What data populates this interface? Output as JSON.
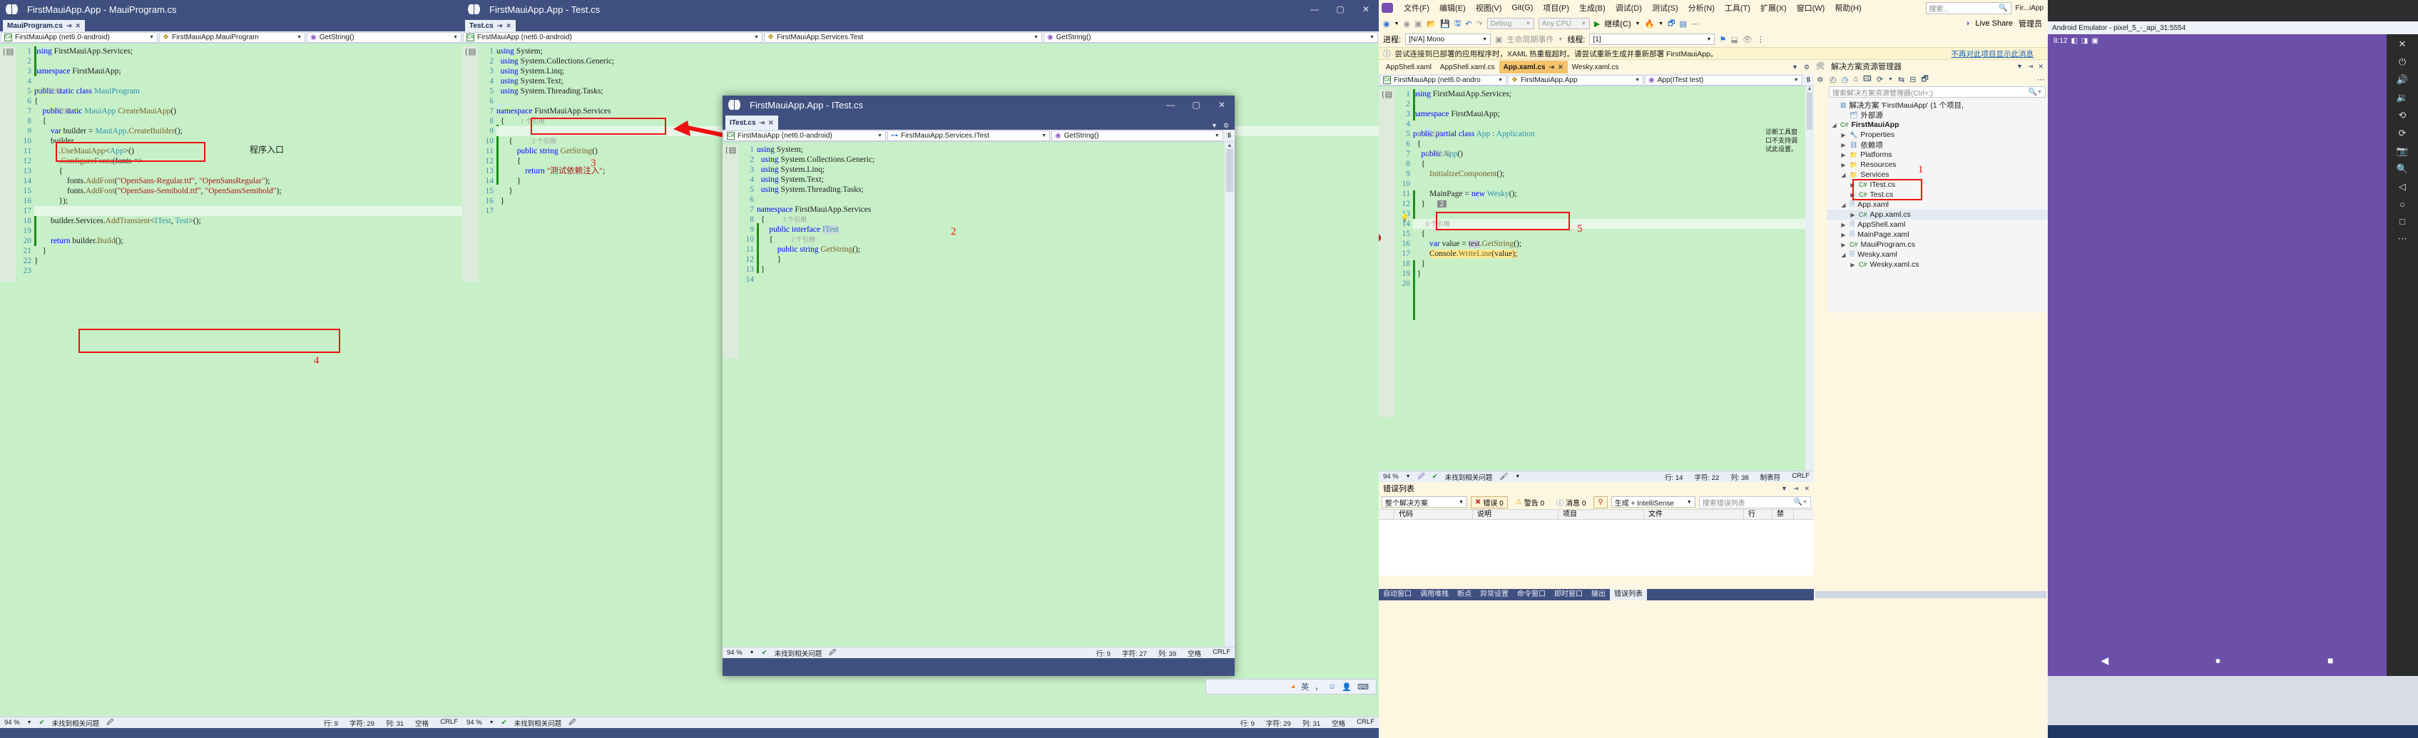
{
  "window1": {
    "title": "FirstMauiApp.App - MauiProgram.cs",
    "tab": "MauiProgram.cs",
    "nav": {
      "project": "FirstMauiApp (net6.0-android)",
      "type": "FirstMauiApp.MauiProgram",
      "member": "GetString()"
    },
    "annotation_program_entry": "程序入口",
    "marker_4": "4",
    "lines": [
      {
        "n": "1",
        "code": "using FirstMauiApp.Services;"
      },
      {
        "n": "2",
        "code": ""
      },
      {
        "n": "3",
        "code": "namespace FirstMauiApp;"
      },
      {
        "n": "4",
        "code": ""
      },
      {
        "n": "5",
        "code": "public static class MauiProgram"
      },
      {
        "n": "6",
        "code": "{"
      },
      {
        "n": "7",
        "code": "    public static MauiApp CreateMauiApp()"
      },
      {
        "n": "8",
        "code": "    {"
      },
      {
        "n": "9",
        "code": "        var builder = MauiApp.CreateBuilder();"
      },
      {
        "n": "10",
        "code": "        builder"
      },
      {
        "n": "11",
        "code": "            .UseMauiApp<App>()"
      },
      {
        "n": "12",
        "code": "            .ConfigureFonts(fonts =>"
      },
      {
        "n": "13",
        "code": "            {"
      },
      {
        "n": "14",
        "code": "                fonts.AddFont(\"OpenSans-Regular.ttf\", \"OpenSansRegular\");"
      },
      {
        "n": "15",
        "code": "                fonts.AddFont(\"OpenSans-Semibold.ttf\", \"OpenSansSemibold\");"
      },
      {
        "n": "16",
        "code": "            });"
      },
      {
        "n": "17",
        "code": ""
      },
      {
        "n": "18",
        "code": "        builder.Services.AddTransient<ITest, Test>();"
      },
      {
        "n": "19",
        "code": ""
      },
      {
        "n": "20",
        "code": "        return builder.Build();"
      },
      {
        "n": "21",
        "code": "    }"
      },
      {
        "n": "22",
        "code": "}"
      },
      {
        "n": "23",
        "code": ""
      }
    ],
    "refhint_class": "4 个引用",
    "refhint_method": "4 个引用",
    "status": {
      "zoom": "94 %",
      "issues": "未找到相关问题",
      "row": "行: 9",
      "char": "字符: 29",
      "col": "列: 31",
      "tab": "空格",
      "eol": "CRLF"
    }
  },
  "window2": {
    "title": "FirstMauiApp.App - Test.cs",
    "tab": "Test.cs",
    "nav": {
      "project": "FirstMauiApp (net6.0-android)",
      "type": "FirstMauiApp.Services.Test",
      "member": "GetString()"
    },
    "marker_3": "3",
    "refhint_class": "1 个引用",
    "refhint_method": "2 个引用",
    "lines": [
      {
        "n": "1",
        "code": "using System;"
      },
      {
        "n": "2",
        "code": "using System.Collections.Generic;"
      },
      {
        "n": "3",
        "code": "using System.Linq;"
      },
      {
        "n": "4",
        "code": "using System.Text;"
      },
      {
        "n": "5",
        "code": "using System.Threading.Tasks;"
      },
      {
        "n": "6",
        "code": ""
      },
      {
        "n": "7",
        "code": "namespace FirstMauiApp.Services"
      },
      {
        "n": "8",
        "code": "{"
      },
      {
        "n": "9",
        "code": "    public class Test: ITest"
      },
      {
        "n": "10",
        "code": "    {"
      },
      {
        "n": "11",
        "code": "        public string GetString()"
      },
      {
        "n": "12",
        "code": "        {"
      },
      {
        "n": "13",
        "code": "            return \"测试依赖注入\";"
      },
      {
        "n": "14",
        "code": "        }"
      },
      {
        "n": "15",
        "code": "    }"
      },
      {
        "n": "16",
        "code": "}"
      },
      {
        "n": "17",
        "code": ""
      }
    ],
    "status": {
      "zoom": "94 %",
      "issues": "未找到相关问题",
      "row": "行: 9",
      "char": "字符: 29",
      "col": "列: 31",
      "tab": "空格",
      "eol": "CRLF"
    }
  },
  "window3": {
    "title": "FirstMauiApp.App - ITest.cs",
    "tab": "ITest.cs",
    "nav": {
      "project": "FirstMauiApp (net6.0-android)",
      "type": "FirstMauiApp.Services.ITest",
      "member": "GetString()"
    },
    "marker_2": "2",
    "refhint_iface": "3 个引用",
    "refhint_method": "2 个引用",
    "lines": [
      {
        "n": "1",
        "code": "using System;"
      },
      {
        "n": "2",
        "code": "using System.Collections.Generic;"
      },
      {
        "n": "3",
        "code": "using System.Linq;"
      },
      {
        "n": "4",
        "code": "using System.Text;"
      },
      {
        "n": "5",
        "code": "using System.Threading.Tasks;"
      },
      {
        "n": "6",
        "code": ""
      },
      {
        "n": "7",
        "code": "namespace FirstMauiApp.Services"
      },
      {
        "n": "8",
        "code": "{"
      },
      {
        "n": "9",
        "code": "    public interface ITest"
      },
      {
        "n": "10",
        "code": "    {"
      },
      {
        "n": "11",
        "code": "        public string GetString();"
      },
      {
        "n": "12",
        "code": "    }"
      },
      {
        "n": "13",
        "code": "}"
      },
      {
        "n": "14",
        "code": ""
      }
    ],
    "status": {
      "zoom": "94 %",
      "issues": "未找到相关问题",
      "row": "行: 9",
      "char": "字符: 27",
      "col": "列: 39",
      "tab": "空格",
      "eol": "CRLF"
    }
  },
  "window4": {
    "menus": [
      "文件(F)",
      "编辑(E)",
      "视图(V)",
      "Git(G)",
      "项目(P)",
      "生成(B)",
      "调试(D)",
      "测试(S)",
      "分析(N)",
      "工具(T)",
      "扩展(X)",
      "窗口(W)",
      "帮助(H)"
    ],
    "search_placeholder": "搜索...",
    "titlebar_text": "Fir...iApp",
    "live_share": "Live Share",
    "feedback": "管理员",
    "toolbar": {
      "config": "Debug",
      "platform": "Any CPU",
      "run": "继续(C)"
    },
    "debugbar": {
      "process_label": "进程:",
      "process_value": "[N/A] Mono",
      "lifecycle": "生命周期事件",
      "thread_label": "线程:",
      "thread_value": "[1]"
    },
    "infobar": {
      "message": "尝试连接到已部署的应用程序时，XAML 热重载超时。请尝试重新生成并重新部署 FirstMauiApp。",
      "link": "不再对此项目显示此消息"
    },
    "tabs": [
      {
        "label": "AppShell.xaml",
        "active": false
      },
      {
        "label": "AppShell.xaml.cs",
        "active": false
      },
      {
        "label": "App.xaml.cs",
        "active": true
      },
      {
        "label": "Wesky.xaml.cs",
        "active": false
      }
    ],
    "nav": {
      "project": "FirstMauiApp (net6.0-andro",
      "type": "FirstMauiApp.App",
      "member": "App(ITest test)"
    },
    "marker_5": "5",
    "marker_2_badge": "2",
    "refhint_class": "6 个引用",
    "refhint_ctor": "0 个引用",
    "refhint_ctor2": "0 个引用",
    "lines": [
      {
        "n": "1",
        "code": "using FirstMauiApp.Services;"
      },
      {
        "n": "2",
        "code": ""
      },
      {
        "n": "3",
        "code": "namespace FirstMauiApp;"
      },
      {
        "n": "4",
        "code": ""
      },
      {
        "n": "5",
        "code": "public partial class App : Application"
      },
      {
        "n": "6",
        "code": "{"
      },
      {
        "n": "7",
        "code": "    public App()"
      },
      {
        "n": "8",
        "code": "    {"
      },
      {
        "n": "9",
        "code": "        InitializeComponent();"
      },
      {
        "n": "10",
        "code": ""
      },
      {
        "n": "11",
        "code": "        MainPage = new Wesky();"
      },
      {
        "n": "12",
        "code": "    }"
      },
      {
        "n": "13",
        "code": ""
      },
      {
        "n": "14",
        "code": "    public App(ITest test)"
      },
      {
        "n": "15",
        "code": "    {"
      },
      {
        "n": "16",
        "code": "        var value = test.GetString();"
      },
      {
        "n": "17",
        "code": "        Console.WriteLine(value);"
      },
      {
        "n": "18",
        "code": "    }"
      },
      {
        "n": "19",
        "code": "}"
      },
      {
        "n": "20",
        "code": ""
      }
    ],
    "status": {
      "zoom": "94 %",
      "issues": "未找到相关问题",
      "row": "行: 14",
      "char": "字符: 22",
      "col": "列: 38",
      "tab": "制表符",
      "eol": "CRLF"
    },
    "diagnostic_tool_text": "诊断工具窗口不支持调试此设置。",
    "solution_explorer": {
      "title": "解决方案资源管理器",
      "search_placeholder": "搜索解决方案资源管理器(Ctrl+;)",
      "marker_1": "1",
      "items": [
        {
          "label": "解决方案 'FirstMauiApp' (1 个项目,",
          "icon": "solution",
          "indent": 0,
          "twisty": "",
          "bold": false
        },
        {
          "label": "外部源",
          "icon": "ext",
          "indent": 1,
          "twisty": "",
          "bold": false
        },
        {
          "label": "FirstMauiApp",
          "icon": "csproj",
          "indent": 0,
          "twisty": "▲",
          "bold": true
        },
        {
          "label": "Properties",
          "icon": "props",
          "indent": 1,
          "twisty": "▶",
          "bold": false
        },
        {
          "label": "依赖项",
          "icon": "deps",
          "indent": 1,
          "twisty": "▶",
          "bold": false
        },
        {
          "label": "Platforms",
          "icon": "folder",
          "indent": 1,
          "twisty": "▶",
          "bold": false
        },
        {
          "label": "Resources",
          "icon": "folder",
          "indent": 1,
          "twisty": "▶",
          "bold": false
        },
        {
          "label": "Services",
          "icon": "folder",
          "indent": 1,
          "twisty": "▲",
          "bold": false
        },
        {
          "label": "ITest.cs",
          "icon": "cs",
          "indent": 2,
          "twisty": "▶",
          "bold": false
        },
        {
          "label": "Test.cs",
          "icon": "cs",
          "indent": 2,
          "twisty": "▶",
          "bold": false
        },
        {
          "label": "App.xaml",
          "icon": "xaml",
          "indent": 1,
          "twisty": "▲",
          "bold": false
        },
        {
          "label": "App.xaml.cs",
          "icon": "cs",
          "indent": 2,
          "twisty": "▶",
          "bold": false,
          "selected": true
        },
        {
          "label": "AppShell.xaml",
          "icon": "xaml",
          "indent": 1,
          "twisty": "▶",
          "bold": false
        },
        {
          "label": "MainPage.xaml",
          "icon": "xaml",
          "indent": 1,
          "twisty": "▶",
          "bold": false
        },
        {
          "label": "MauiProgram.cs",
          "icon": "cs",
          "indent": 1,
          "twisty": "▶",
          "bold": false
        },
        {
          "label": "Wesky.xaml",
          "icon": "xaml",
          "indent": 1,
          "twisty": "▲",
          "bold": false
        },
        {
          "label": "Wesky.xaml.cs",
          "icon": "cs",
          "indent": 2,
          "twisty": "▶",
          "bold": false
        }
      ]
    },
    "error_list": {
      "title": "错误列表",
      "scope": "整个解决方案",
      "errors": "错误 0",
      "warnings": "警告 0",
      "messages": "消息 0",
      "build_filter": "生成 + IntelliSense",
      "search_placeholder": "搜索错误列表",
      "columns": [
        "",
        "代码",
        "说明",
        "项目",
        "文件",
        "行",
        "禁"
      ]
    },
    "bottom_tabs": [
      "自动窗口",
      "调用堆栈",
      "断点",
      "异常设置",
      "命令窗口",
      "即时窗口",
      "输出",
      "错误列表"
    ],
    "bottom_tab_active": "错误列表"
  },
  "emulator": {
    "title": "Android Emulator - pixel_5_-_api_31:5554",
    "clock": "8:12"
  },
  "colors": {
    "vs_blue": "#3f5080",
    "code_bg": "#c8f0c8",
    "accent_tab": "#f6c36b",
    "marker_red": "#ee1111"
  }
}
